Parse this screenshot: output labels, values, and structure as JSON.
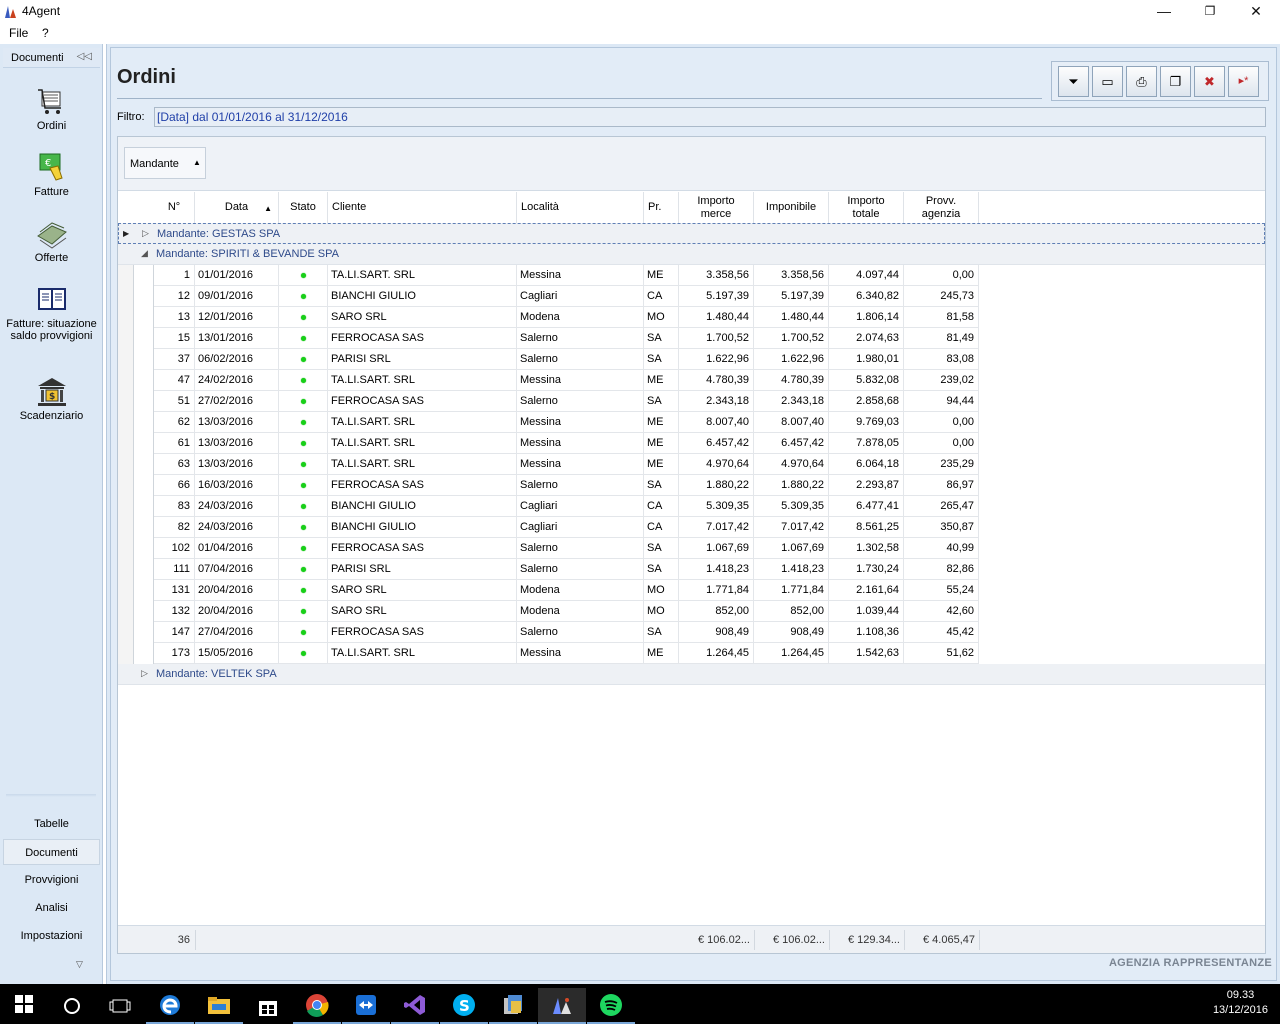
{
  "window": {
    "title": "4Agent"
  },
  "menu": [
    "File",
    "?"
  ],
  "sidebar": {
    "header": "Documenti",
    "items": [
      {
        "label": "Ordini",
        "icon": "orders-cart-icon"
      },
      {
        "label": "Fatture",
        "icon": "invoice-money-icon"
      },
      {
        "label": "Offerte",
        "icon": "offers-money-icon"
      },
      {
        "label": "Fatture: situazione saldo provvigioni",
        "icon": "invoice-book-icon"
      },
      {
        "label": "Scadenziario",
        "icon": "bank-icon"
      }
    ],
    "groups": [
      "Tabelle",
      "Documenti",
      "Provvigioni",
      "Analisi",
      "Impostazioni"
    ],
    "active_group": "Documenti"
  },
  "page": {
    "title": "Ordini",
    "filter_label": "Filtro:",
    "filter_value": "[Data] dal 01/01/2016 al 31/12/2016"
  },
  "toolbar": [
    {
      "name": "filter-icon",
      "glyph": "⏷"
    },
    {
      "name": "card-icon",
      "glyph": "▭"
    },
    {
      "name": "print-icon",
      "glyph": "⎙"
    },
    {
      "name": "copy-icon",
      "glyph": "❐"
    },
    {
      "name": "delete-icon",
      "glyph": "✖"
    },
    {
      "name": "new-icon",
      "glyph": "▸*"
    }
  ],
  "grid": {
    "group_by": "Mandante",
    "columns": [
      "N°",
      "Data",
      "Stato",
      "Cliente",
      "Località",
      "Pr.",
      "Importo merce",
      "Imponibile",
      "Importo totale",
      "Provv. agenzia"
    ],
    "groups": [
      {
        "label": "Mandante: GESTAS SPA",
        "expanded": false
      },
      {
        "label": "Mandante: SPIRITI & BEVANDE SPA",
        "expanded": true
      },
      {
        "label": "Mandante: VELTEK SPA",
        "expanded": false
      }
    ],
    "rows": [
      [
        "1",
        "01/01/2016",
        "TA.LI.SART. SRL",
        "Messina",
        "ME",
        "3.358,56",
        "3.358,56",
        "4.097,44",
        "0,00"
      ],
      [
        "12",
        "09/01/2016",
        "BIANCHI GIULIO",
        "Cagliari",
        "CA",
        "5.197,39",
        "5.197,39",
        "6.340,82",
        "245,73"
      ],
      [
        "13",
        "12/01/2016",
        "SARO SRL",
        "Modena",
        "MO",
        "1.480,44",
        "1.480,44",
        "1.806,14",
        "81,58"
      ],
      [
        "15",
        "13/01/2016",
        "FERROCASA SAS",
        "Salerno",
        "SA",
        "1.700,52",
        "1.700,52",
        "2.074,63",
        "81,49"
      ],
      [
        "37",
        "06/02/2016",
        "PARISI SRL",
        "Salerno",
        "SA",
        "1.622,96",
        "1.622,96",
        "1.980,01",
        "83,08"
      ],
      [
        "47",
        "24/02/2016",
        "TA.LI.SART. SRL",
        "Messina",
        "ME",
        "4.780,39",
        "4.780,39",
        "5.832,08",
        "239,02"
      ],
      [
        "51",
        "27/02/2016",
        "FERROCASA SAS",
        "Salerno",
        "SA",
        "2.343,18",
        "2.343,18",
        "2.858,68",
        "94,44"
      ],
      [
        "62",
        "13/03/2016",
        "TA.LI.SART. SRL",
        "Messina",
        "ME",
        "8.007,40",
        "8.007,40",
        "9.769,03",
        "0,00"
      ],
      [
        "61",
        "13/03/2016",
        "TA.LI.SART. SRL",
        "Messina",
        "ME",
        "6.457,42",
        "6.457,42",
        "7.878,05",
        "0,00"
      ],
      [
        "63",
        "13/03/2016",
        "TA.LI.SART. SRL",
        "Messina",
        "ME",
        "4.970,64",
        "4.970,64",
        "6.064,18",
        "235,29"
      ],
      [
        "66",
        "16/03/2016",
        "FERROCASA SAS",
        "Salerno",
        "SA",
        "1.880,22",
        "1.880,22",
        "2.293,87",
        "86,97"
      ],
      [
        "83",
        "24/03/2016",
        "BIANCHI GIULIO",
        "Cagliari",
        "CA",
        "5.309,35",
        "5.309,35",
        "6.477,41",
        "265,47"
      ],
      [
        "82",
        "24/03/2016",
        "BIANCHI GIULIO",
        "Cagliari",
        "CA",
        "7.017,42",
        "7.017,42",
        "8.561,25",
        "350,87"
      ],
      [
        "102",
        "01/04/2016",
        "FERROCASA SAS",
        "Salerno",
        "SA",
        "1.067,69",
        "1.067,69",
        "1.302,58",
        "40,99"
      ],
      [
        "111",
        "07/04/2016",
        "PARISI SRL",
        "Salerno",
        "SA",
        "1.418,23",
        "1.418,23",
        "1.730,24",
        "82,86"
      ],
      [
        "131",
        "20/04/2016",
        "SARO SRL",
        "Modena",
        "MO",
        "1.771,84",
        "1.771,84",
        "2.161,64",
        "55,24"
      ],
      [
        "132",
        "20/04/2016",
        "SARO SRL",
        "Modena",
        "MO",
        "852,00",
        "852,00",
        "1.039,44",
        "42,60"
      ],
      [
        "147",
        "27/04/2016",
        "FERROCASA SAS",
        "Salerno",
        "SA",
        "908,49",
        "908,49",
        "1.108,36",
        "45,42"
      ],
      [
        "173",
        "15/05/2016",
        "TA.LI.SART. SRL",
        "Messina",
        "ME",
        "1.264,45",
        "1.264,45",
        "1.542,63",
        "51,62"
      ]
    ],
    "footer": {
      "count": "36",
      "importo_merce": "€ 106.02...",
      "imponibile": "€ 106.02...",
      "importo_totale": "€ 129.34...",
      "provv": "€ 4.065,47"
    }
  },
  "brand": "AGENZIA RAPPRESENTANZE",
  "window_controls": [
    "—",
    "❐",
    "✕"
  ],
  "clock": {
    "time": "09.33",
    "date": "13/12/2016"
  },
  "taskbar": [
    "windows-start-icon",
    "cortana-icon",
    "task-view-icon",
    "edge-icon",
    "file-explorer-icon",
    "store-icon",
    "chrome-icon",
    "teamviewer-icon",
    "visual-studio-icon",
    "skype-icon",
    "app-icon",
    "4agent-icon",
    "spotify-icon"
  ]
}
